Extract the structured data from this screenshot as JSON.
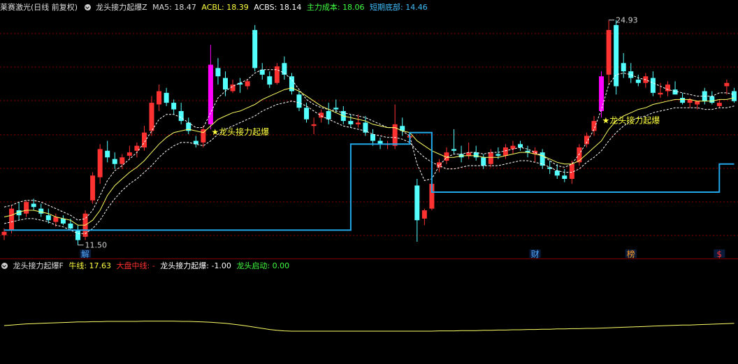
{
  "main_header": {
    "stock_name": "莱赛激光(日线 前复权)",
    "indicator_name": "龙头接力起爆Z",
    "ma5_label": "MA5:",
    "ma5_value": "18.47",
    "acbl_label": "ACBL:",
    "acbl_value": "18.39",
    "acbs_label": "ACBS:",
    "acbs_value": "18.14",
    "cost_label": "主力成本:",
    "cost_value": "18.06",
    "bottom_label": "短期底部:",
    "bottom_value": "14.46"
  },
  "sub_header": {
    "indicator_name": "龙头接力起爆F",
    "bull_label": "牛线:",
    "bull_value": "17.63",
    "midline_label": "大盘中线:",
    "midline_value": "-",
    "signal_label": "龙头接力起爆:",
    "signal_value": "-1.00",
    "start_label": "龙头启动:",
    "start_value": "0.00"
  },
  "annotations": {
    "high_label": "24.93",
    "low_label": "11.50",
    "signal_text_1": "★龙头接力起爆",
    "signal_text_2": "★龙头接力起爆"
  },
  "event_markers": [
    {
      "label": "解",
      "color": "#4fa8ff",
      "kind": "unlock"
    },
    {
      "label": "财",
      "color": "#4fa8ff",
      "kind": "finance"
    },
    {
      "label": "榜",
      "color": "#ff9c2a",
      "kind": "rank"
    },
    {
      "label": "$",
      "color": "#ff3030",
      "kind": "dividend"
    }
  ],
  "colors": {
    "up": "#ff3232",
    "down": "#54ffff",
    "signal_bar": "#ff00ff",
    "ma_line": "#ffff66",
    "band_line": "#ffffff",
    "bottom_line": "#20a8e8",
    "grid": "#8b0000",
    "ma5_text": "#dddddd",
    "acbl_text": "#ffff40",
    "acbs_text": "#ffffff",
    "cost_text": "#40ff40",
    "bottom_text": "#40c0ff",
    "bull_text": "#ffff40",
    "midline_text": "#ff3030",
    "signal_text": "#ffffff",
    "start_text": "#40ff40"
  },
  "candles": [
    [
      11.9,
      12.3,
      11.6,
      12.1
    ],
    [
      12.2,
      13.7,
      12.0,
      13.5
    ],
    [
      13.4,
      13.9,
      12.8,
      13.1
    ],
    [
      13.2,
      14.0,
      13.0,
      13.9
    ],
    [
      13.8,
      14.1,
      13.4,
      13.6
    ],
    [
      13.5,
      13.8,
      13.0,
      13.2
    ],
    [
      13.1,
      13.5,
      12.6,
      12.8
    ],
    [
      12.7,
      13.2,
      12.4,
      13.0
    ],
    [
      12.9,
      13.1,
      12.5,
      12.6
    ],
    [
      12.6,
      12.9,
      12.2,
      12.3
    ],
    [
      12.2,
      12.5,
      11.3,
      11.6
    ],
    [
      11.8,
      13.4,
      11.6,
      13.2
    ],
    [
      14.0,
      15.7,
      13.8,
      15.5
    ],
    [
      15.4,
      17.4,
      15.0,
      17.1
    ],
    [
      17.0,
      17.6,
      16.3,
      16.6
    ],
    [
      16.5,
      16.9,
      15.9,
      16.2
    ],
    [
      16.2,
      16.8,
      15.9,
      16.6
    ],
    [
      16.7,
      17.3,
      16.5,
      16.9
    ],
    [
      17.0,
      17.5,
      16.6,
      17.3
    ],
    [
      17.2,
      18.5,
      17.0,
      18.1
    ],
    [
      18.2,
      20.3,
      17.9,
      19.9
    ],
    [
      19.8,
      21.0,
      19.4,
      20.6
    ],
    [
      20.5,
      20.8,
      19.7,
      19.9
    ],
    [
      19.9,
      20.1,
      19.2,
      19.5
    ],
    [
      19.4,
      19.9,
      18.6,
      18.8
    ],
    [
      18.7,
      19.0,
      18.0,
      18.2
    ],
    [
      17.6,
      17.9,
      17.2,
      17.4
    ],
    [
      17.5,
      18.5,
      17.2,
      18.3
    ],
    [
      18.6,
      23.4,
      18.3,
      22.2
    ],
    [
      22.0,
      22.6,
      21.0,
      21.5
    ],
    [
      21.4,
      21.8,
      20.3,
      20.7
    ],
    [
      20.6,
      21.3,
      20.5,
      21.0
    ],
    [
      21.1,
      21.4,
      20.5,
      21.0
    ],
    [
      20.9,
      21.3,
      20.7,
      21.2
    ],
    [
      24.3,
      24.6,
      21.8,
      22.0
    ],
    [
      21.9,
      22.3,
      21.3,
      21.6
    ],
    [
      21.5,
      21.8,
      20.8,
      21.0
    ],
    [
      21.1,
      22.3,
      21.0,
      22.1
    ],
    [
      22.3,
      22.7,
      21.3,
      21.6
    ],
    [
      21.5,
      21.7,
      20.4,
      20.6
    ],
    [
      20.4,
      20.6,
      19.4,
      19.6
    ],
    [
      19.6,
      19.9,
      18.7,
      18.9
    ],
    [
      18.5,
      19.0,
      18.0,
      18.6
    ],
    [
      19.0,
      19.5,
      18.7,
      19.3
    ],
    [
      19.4,
      19.9,
      18.6,
      18.9
    ],
    [
      19.6,
      20.1,
      19.3,
      19.5
    ],
    [
      19.4,
      19.7,
      18.6,
      18.8
    ],
    [
      18.8,
      19.2,
      18.4,
      18.6
    ],
    [
      18.6,
      19.2,
      18.4,
      18.7
    ],
    [
      18.7,
      19.1,
      17.9,
      18.1
    ],
    [
      18.0,
      18.3,
      17.3,
      17.6
    ],
    [
      17.6,
      17.8,
      17.1,
      17.4
    ],
    [
      17.4,
      17.6,
      17.1,
      17.4
    ],
    [
      17.3,
      19.8,
      17.1,
      18.6
    ],
    [
      18.5,
      19.0,
      17.9,
      18.2
    ],
    [
      17.8,
      18.0,
      17.6,
      17.9
    ],
    [
      14.9,
      15.3,
      11.5,
      12.8
    ],
    [
      12.9,
      13.5,
      12.5,
      13.4
    ],
    [
      13.5,
      15.2,
      13.4,
      15.0
    ],
    [
      16.0,
      16.5,
      15.7,
      16.3
    ],
    [
      16.4,
      17.2,
      16.2,
      16.9
    ],
    [
      17.1,
      18.3,
      16.8,
      17.0
    ],
    [
      16.8,
      17.3,
      16.3,
      16.6
    ],
    [
      16.7,
      17.5,
      16.5,
      16.9
    ],
    [
      16.9,
      17.3,
      16.4,
      16.6
    ],
    [
      16.6,
      16.8,
      15.9,
      16.1
    ],
    [
      16.2,
      17.1,
      16.0,
      16.9
    ],
    [
      16.8,
      17.2,
      16.5,
      16.7
    ],
    [
      16.7,
      17.4,
      16.5,
      17.2
    ],
    [
      17.1,
      17.6,
      16.8,
      17.3
    ],
    [
      17.4,
      17.6,
      17.0,
      17.2
    ],
    [
      17.0,
      17.3,
      16.6,
      16.9
    ],
    [
      16.8,
      17.2,
      16.3,
      17.0
    ],
    [
      16.9,
      17.1,
      15.9,
      16.1
    ],
    [
      16.0,
      16.4,
      15.6,
      15.9
    ],
    [
      15.8,
      16.2,
      15.3,
      15.5
    ],
    [
      15.5,
      15.9,
      15.1,
      15.3
    ],
    [
      15.3,
      16.4,
      15.0,
      16.2
    ],
    [
      16.3,
      17.4,
      16.1,
      17.2
    ],
    [
      17.4,
      18.1,
      17.2,
      17.9
    ],
    [
      18.2,
      19.1,
      17.9,
      18.8
    ],
    [
      19.4,
      21.8,
      19.0,
      21.5
    ],
    [
      21.6,
      24.9,
      21.0,
      24.3
    ],
    [
      24.6,
      24.9,
      20.4,
      20.9
    ],
    [
      22.3,
      22.9,
      21.4,
      21.8
    ],
    [
      21.8,
      22.3,
      21.1,
      21.4
    ],
    [
      21.3,
      21.6,
      20.9,
      21.1
    ],
    [
      21.1,
      21.7,
      20.8,
      21.5
    ],
    [
      21.4,
      21.8,
      20.3,
      20.5
    ],
    [
      20.4,
      21.1,
      20.2,
      20.5
    ],
    [
      20.6,
      21.2,
      20.3,
      21.0
    ],
    [
      20.7,
      21.2,
      20.4,
      20.4
    ],
    [
      20.2,
      20.5,
      19.8,
      19.9
    ],
    [
      19.9,
      20.2,
      19.6,
      20.1
    ],
    [
      19.8,
      20.0,
      19.5,
      20.0
    ],
    [
      20.6,
      20.8,
      19.8,
      20.0
    ],
    [
      20.3,
      20.6,
      19.8,
      19.9
    ],
    [
      19.7,
      20.1,
      19.6,
      19.9
    ],
    [
      20.9,
      21.3,
      20.4,
      21.1
    ],
    [
      20.6,
      20.8,
      19.9,
      20.0
    ]
  ],
  "signal_candles": [
    28,
    81
  ],
  "ma_line": [
    13.0,
    13.1,
    13.3,
    13.4,
    13.4,
    13.3,
    13.2,
    13.0,
    12.9,
    12.8,
    12.5,
    12.5,
    12.8,
    13.4,
    14.3,
    14.9,
    15.3,
    15.7,
    16.0,
    16.4,
    16.9,
    17.4,
    17.8,
    18.1,
    18.2,
    18.3,
    18.2,
    18.1,
    18.5,
    18.9,
    19.1,
    19.3,
    19.4,
    19.6,
    19.8,
    20.1,
    20.3,
    20.5,
    20.7,
    20.8,
    20.6,
    20.3,
    20.0,
    19.7,
    19.5,
    19.3,
    19.1,
    19.0,
    18.9,
    18.8,
    18.6,
    18.5,
    18.4,
    18.4,
    18.2,
    18.1,
    17.6,
    17.3,
    17.0,
    16.8,
    16.6,
    16.6,
    16.7,
    16.7,
    16.7,
    16.6,
    16.6,
    16.6,
    16.7,
    16.8,
    16.9,
    16.9,
    16.8,
    16.7,
    16.5,
    16.3,
    16.2,
    16.2,
    16.4,
    16.8,
    17.2,
    17.6,
    18.3,
    18.8,
    19.1,
    19.3,
    19.5,
    19.6,
    19.8,
    19.9,
    20.0,
    20.1,
    20.1,
    20.1,
    20.0,
    20.0,
    20.0,
    20.1,
    20.1,
    20.2
  ],
  "upper_band": [
    13.6,
    13.7,
    13.9,
    14.0,
    14.0,
    13.9,
    13.7,
    13.5,
    13.3,
    13.1,
    12.8,
    12.9,
    13.4,
    14.3,
    15.2,
    15.8,
    16.1,
    16.5,
    16.9,
    17.5,
    18.2,
    18.9,
    19.2,
    19.2,
    19.0,
    18.7,
    18.4,
    18.4,
    19.3,
    20.2,
    20.6,
    20.9,
    21.1,
    21.3,
    21.7,
    21.9,
    21.9,
    21.9,
    21.7,
    21.3,
    20.7,
    20.1,
    19.8,
    19.6,
    19.5,
    19.4,
    19.3,
    19.2,
    19.1,
    19.0,
    18.8,
    18.6,
    18.4,
    18.4,
    18.2,
    17.9,
    16.2,
    15.2,
    15.3,
    16.1,
    16.6,
    16.8,
    16.8,
    16.9,
    16.9,
    16.8,
    16.9,
    16.9,
    17.0,
    17.1,
    17.2,
    17.1,
    16.9,
    16.7,
    16.4,
    16.1,
    16.0,
    16.2,
    16.8,
    17.5,
    18.3,
    19.5,
    21.0,
    21.6,
    21.7,
    21.6,
    21.4,
    21.3,
    21.1,
    20.9,
    20.7,
    20.6,
    20.5,
    20.4,
    20.3,
    20.3,
    20.3,
    20.5,
    20.5,
    20.4
  ],
  "lower_band": [
    12.6,
    12.7,
    12.8,
    12.9,
    12.9,
    12.8,
    12.7,
    12.5,
    12.4,
    12.2,
    12.0,
    12.0,
    12.3,
    12.8,
    13.5,
    14.1,
    14.6,
    15.0,
    15.3,
    15.7,
    16.1,
    16.6,
    17.0,
    17.3,
    17.5,
    17.5,
    17.4,
    17.3,
    17.6,
    18.0,
    18.3,
    18.5,
    18.7,
    18.9,
    19.1,
    19.4,
    19.6,
    19.8,
    19.9,
    20.0,
    19.9,
    19.7,
    19.4,
    19.1,
    18.9,
    18.7,
    18.5,
    18.4,
    18.3,
    18.2,
    18.0,
    17.9,
    17.8,
    17.8,
    17.7,
    17.5,
    17.0,
    16.6,
    16.3,
    16.1,
    15.9,
    15.9,
    16.0,
    16.1,
    16.1,
    16.1,
    16.1,
    16.1,
    16.2,
    16.3,
    16.4,
    16.4,
    16.3,
    16.2,
    16.0,
    15.8,
    15.7,
    15.7,
    15.9,
    16.3,
    16.6,
    17.0,
    17.6,
    18.1,
    18.5,
    18.8,
    19.0,
    19.1,
    19.3,
    19.4,
    19.5,
    19.6,
    19.6,
    19.6,
    19.6,
    19.5,
    19.5,
    19.6,
    19.6,
    19.7
  ],
  "bottom_steps": [
    {
      "from": 0,
      "to": 11,
      "value": 12.2
    },
    {
      "from": 11,
      "to": 47,
      "value": 12.2
    },
    {
      "from": 47,
      "to": 48,
      "value": 17.4
    },
    {
      "from": 48,
      "to": 55,
      "value": 17.4
    },
    {
      "from": 55,
      "to": 58,
      "value": 18.1
    },
    {
      "from": 58,
      "to": 59,
      "value": 14.5
    },
    {
      "from": 59,
      "to": 97,
      "value": 14.5
    },
    {
      "from": 97,
      "to": 99,
      "value": 16.2
    }
  ],
  "sub_line": [
    0.2,
    0.22,
    0.24,
    0.26,
    0.27,
    0.28,
    0.29,
    0.3,
    0.31,
    0.32,
    0.33,
    0.33,
    0.34,
    0.34,
    0.35,
    0.35,
    0.35,
    0.35,
    0.35,
    0.36,
    0.36,
    0.36,
    0.36,
    0.36,
    0.35,
    0.35,
    0.34,
    0.33,
    0.32,
    0.3,
    0.28,
    0.25,
    0.22,
    0.18,
    0.14,
    0.1,
    0.06,
    0.03,
    0.01,
    0.0,
    0.0,
    0.0,
    0.0,
    0.0,
    0.0,
    0.0,
    0.0,
    0.0,
    0.0,
    0.0,
    0.0,
    0.0,
    0.0,
    0.0,
    0.0,
    0.0,
    0.0,
    0.0,
    0.0,
    0.01,
    0.01,
    0.01,
    0.02,
    0.02,
    0.02,
    0.03,
    0.03,
    0.04,
    0.04,
    0.05,
    0.05,
    0.06,
    0.06,
    0.07,
    0.07,
    0.08,
    0.08,
    0.09,
    0.09,
    0.1,
    0.1,
    0.11,
    0.12,
    0.13,
    0.14,
    0.15,
    0.16,
    0.17,
    0.18,
    0.19,
    0.2,
    0.21,
    0.22,
    0.22,
    0.23,
    0.24,
    0.25,
    0.26,
    0.27,
    0.28
  ]
}
